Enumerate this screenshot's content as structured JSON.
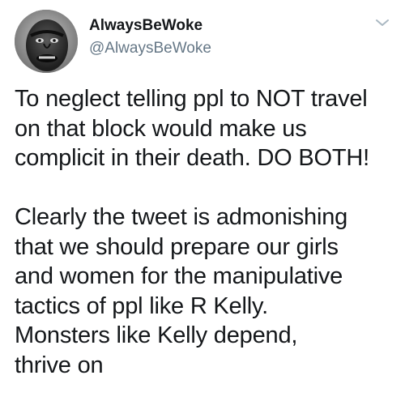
{
  "tweet": {
    "author": {
      "display_name": "AlwaysBeWoke",
      "handle": "@AlwaysBeWoke",
      "avatar_icon": "avatar-photo-icon"
    },
    "menu_icon": "chevron-down-icon",
    "paragraph_1_lines": [
      "To neglect telling ppl to NOT travel",
      "on that block would make us",
      "complicit in their death. DO BOTH!"
    ],
    "paragraph_2_lines": [
      "Clearly the tweet is admonishing",
      "that we should prepare our girls",
      "and women for the manipulative",
      "tactics of ppl like R Kelly.",
      "Monsters like Kelly depend,",
      "thrive on"
    ]
  },
  "colors": {
    "text_primary": "#14171a",
    "text_secondary": "#657786",
    "caret": "#aab8c2"
  }
}
